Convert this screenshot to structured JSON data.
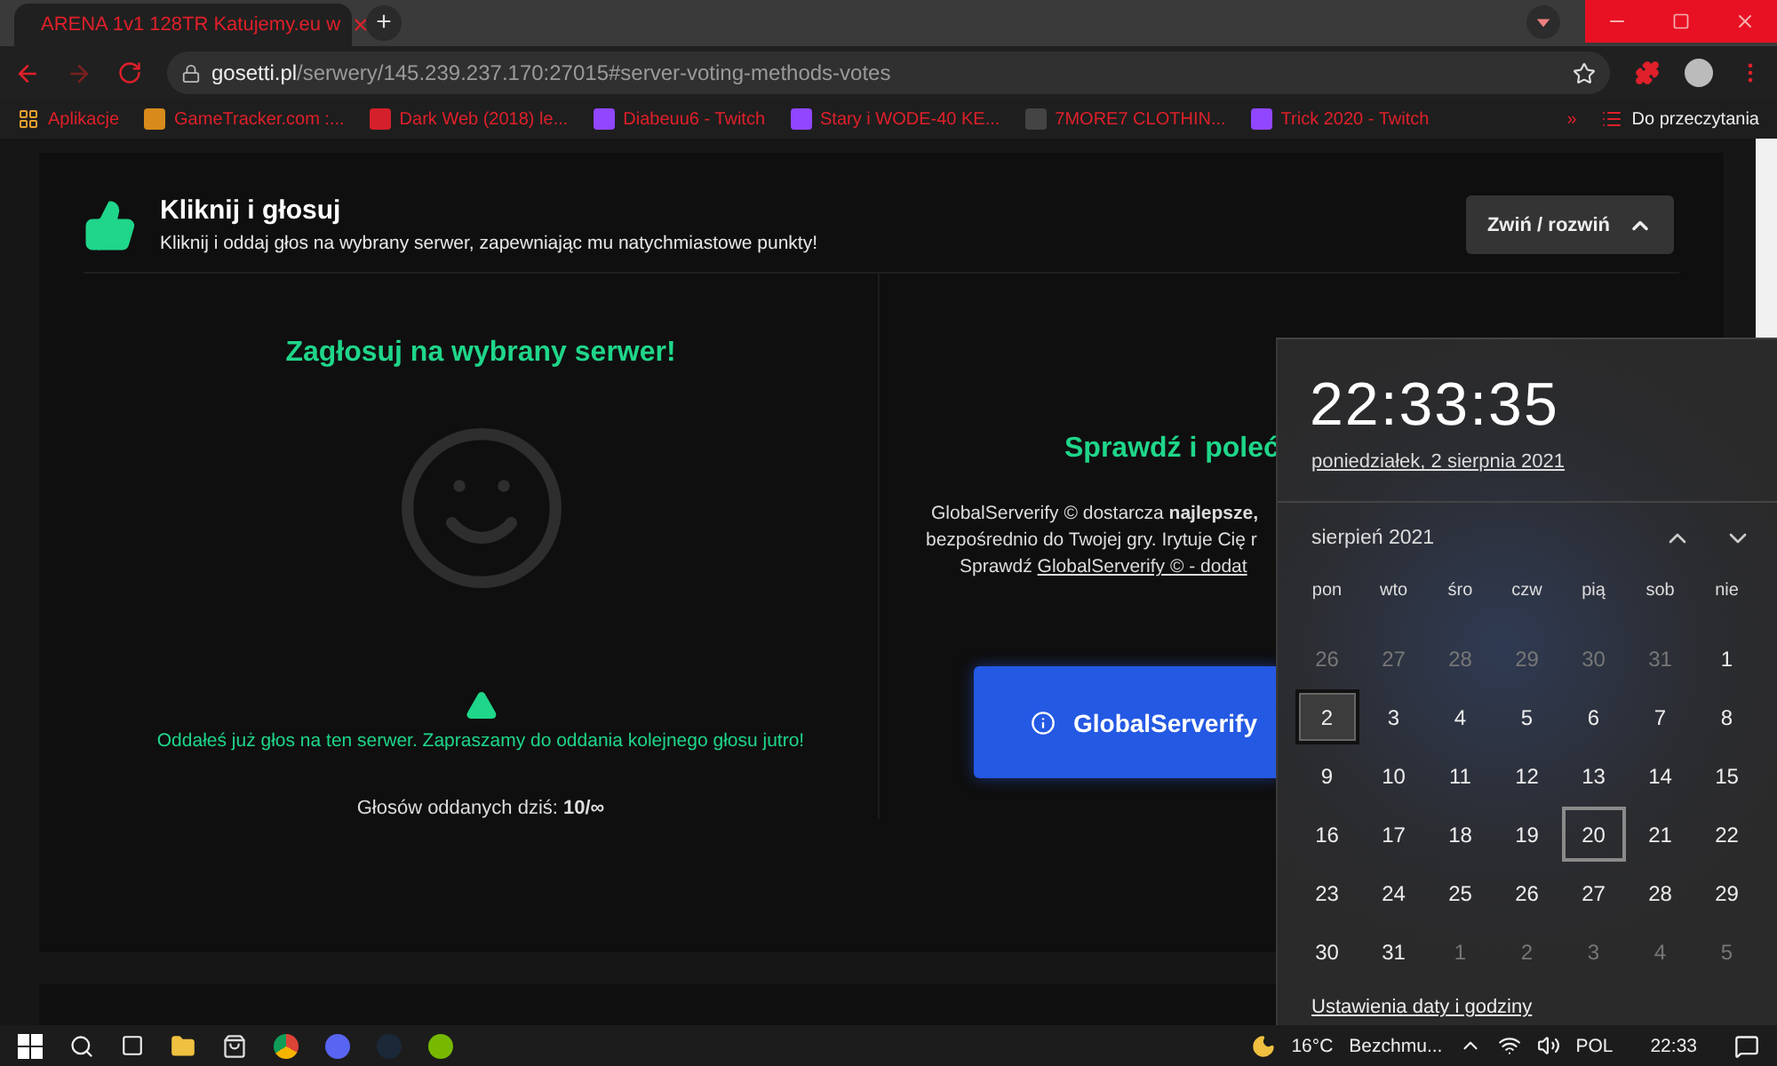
{
  "browser": {
    "tab": {
      "title": "ARENA 1v1 128TR Katujemy.eu w",
      "close": "×"
    },
    "new_tab": "+",
    "address": {
      "host": "gosetti.pl",
      "path": "/serwery/145.239.237.170:27015#server-voting-methods-votes"
    },
    "bookmarks": [
      {
        "label": "Aplikacje",
        "kind": "apps"
      },
      {
        "label": "GameTracker.com :...",
        "kind": "gt"
      },
      {
        "label": "Dark Web (2018) le...",
        "kind": "cda"
      },
      {
        "label": "Diabeuu6 - Twitch",
        "kind": "twitch"
      },
      {
        "label": "Stary i WODE-40 KE...",
        "kind": "twitch"
      },
      {
        "label": "7MORE7 CLOTHIN...",
        "kind": "mark"
      },
      {
        "label": "Trick 2020 - Twitch",
        "kind": "twitch"
      }
    ],
    "more": "»",
    "reading_list": "Do przeczytania"
  },
  "section": {
    "title": "Kliknij i głosuj",
    "subtitle": "Kliknij i oddaj głos na wybrany serwer, zapewniając mu natychmiastowe punkty!",
    "toggle": "Zwiń / rozwiń"
  },
  "vote": {
    "heading": "Zagłosuj na wybrany serwer!",
    "message": "Oddałeś już głos na ten serwer. Zapraszamy do oddania kolejnego głosu jutro!",
    "count_label": "Głosów oddanych dziś:",
    "count": "10/∞"
  },
  "promo": {
    "heading": "Sprawdź i poleć",
    "lines": [
      "GlobalServerify © dostarcza **najlepsze,**",
      "bezpośrednio do Twojej gry. Irytuje Cię r",
      "Sprawdź "
    ],
    "link": "GlobalServerify © - dodat",
    "button": "GlobalServerify"
  },
  "clock": {
    "time": "22:33:35",
    "date": "poniedziałek, 2 sierpnia 2021",
    "month": "sierpień 2021",
    "weekdays": [
      "pon",
      "wto",
      "śro",
      "czw",
      "pią",
      "sob",
      "nie"
    ],
    "days": [
      {
        "label": "26",
        "outside": true,
        "selected": false,
        "hovered": false
      },
      {
        "label": "27",
        "outside": true,
        "selected": false,
        "hovered": false
      },
      {
        "label": "28",
        "outside": true,
        "selected": false,
        "hovered": false
      },
      {
        "label": "29",
        "outside": true,
        "selected": false,
        "hovered": false
      },
      {
        "label": "30",
        "outside": true,
        "selected": false,
        "hovered": false
      },
      {
        "label": "31",
        "outside": true,
        "selected": false,
        "hovered": false
      },
      {
        "label": "1",
        "outside": false,
        "selected": false,
        "hovered": false
      },
      {
        "label": "2",
        "outside": false,
        "selected": true,
        "hovered": false
      },
      {
        "label": "3",
        "outside": false,
        "selected": false,
        "hovered": false
      },
      {
        "label": "4",
        "outside": false,
        "selected": false,
        "hovered": false
      },
      {
        "label": "5",
        "outside": false,
        "selected": false,
        "hovered": false
      },
      {
        "label": "6",
        "outside": false,
        "selected": false,
        "hovered": false
      },
      {
        "label": "7",
        "outside": false,
        "selected": false,
        "hovered": false
      },
      {
        "label": "8",
        "outside": false,
        "selected": false,
        "hovered": false
      },
      {
        "label": "9",
        "outside": false,
        "selected": false,
        "hovered": false
      },
      {
        "label": "10",
        "outside": false,
        "selected": false,
        "hovered": false
      },
      {
        "label": "11",
        "outside": false,
        "selected": false,
        "hovered": false
      },
      {
        "label": "12",
        "outside": false,
        "selected": false,
        "hovered": false
      },
      {
        "label": "13",
        "outside": false,
        "selected": false,
        "hovered": false
      },
      {
        "label": "14",
        "outside": false,
        "selected": false,
        "hovered": false
      },
      {
        "label": "15",
        "outside": false,
        "selected": false,
        "hovered": false
      },
      {
        "label": "16",
        "outside": false,
        "selected": false,
        "hovered": false
      },
      {
        "label": "17",
        "outside": false,
        "selected": false,
        "hovered": false
      },
      {
        "label": "18",
        "outside": false,
        "selected": false,
        "hovered": false
      },
      {
        "label": "19",
        "outside": false,
        "selected": false,
        "hovered": false
      },
      {
        "label": "20",
        "outside": false,
        "selected": false,
        "hovered": true
      },
      {
        "label": "21",
        "outside": false,
        "selected": false,
        "hovered": false
      },
      {
        "label": "22",
        "outside": false,
        "selected": false,
        "hovered": false
      },
      {
        "label": "23",
        "outside": false,
        "selected": false,
        "hovered": false
      },
      {
        "label": "24",
        "outside": false,
        "selected": false,
        "hovered": false
      },
      {
        "label": "25",
        "outside": false,
        "selected": false,
        "hovered": false
      },
      {
        "label": "26",
        "outside": false,
        "selected": false,
        "hovered": false
      },
      {
        "label": "27",
        "outside": false,
        "selected": false,
        "hovered": false
      },
      {
        "label": "28",
        "outside": false,
        "selected": false,
        "hovered": false
      },
      {
        "label": "29",
        "outside": false,
        "selected": false,
        "hovered": false
      },
      {
        "label": "30",
        "outside": false,
        "selected": false,
        "hovered": false
      },
      {
        "label": "31",
        "outside": false,
        "selected": false,
        "hovered": false
      },
      {
        "label": "1",
        "outside": true,
        "selected": false,
        "hovered": false
      },
      {
        "label": "2",
        "outside": true,
        "selected": false,
        "hovered": false
      },
      {
        "label": "3",
        "outside": true,
        "selected": false,
        "hovered": false
      },
      {
        "label": "4",
        "outside": true,
        "selected": false,
        "hovered": false
      },
      {
        "label": "5",
        "outside": true,
        "selected": false,
        "hovered": false
      }
    ],
    "settings_link": "Ustawienia daty i godziny"
  },
  "taskbar": {
    "weather_temp": "16°C",
    "weather_text": "Bezchmu...",
    "language": "POL",
    "time": "22:33"
  }
}
